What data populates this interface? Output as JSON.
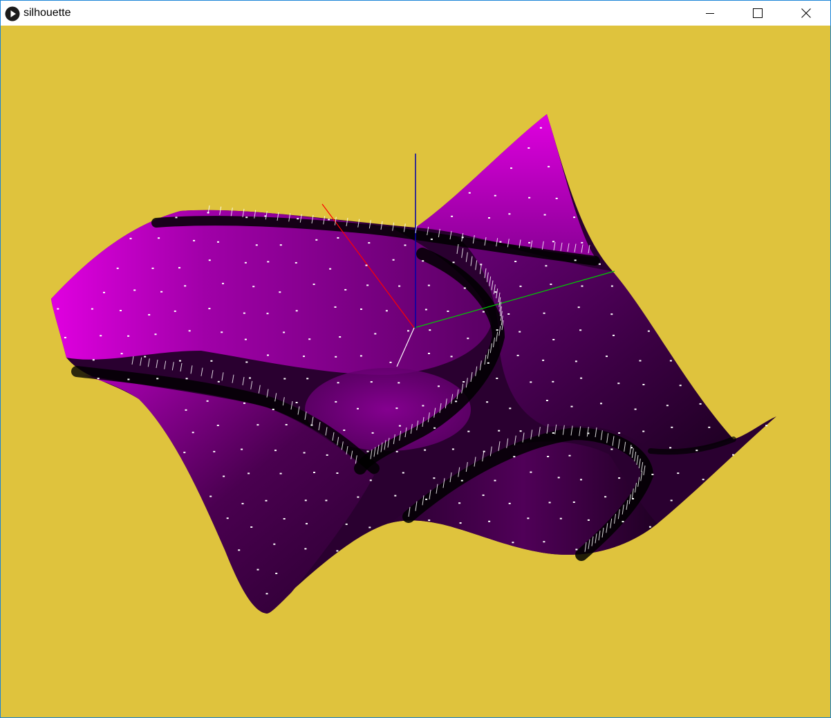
{
  "window": {
    "title": "silhouette",
    "controls": {
      "minimize_icon": "minimize-icon",
      "maximize_icon": "maximize-icon",
      "close_icon": "close-icon"
    }
  },
  "scene": {
    "background_color": "#dfc33d",
    "surface_color": "#e000e0",
    "shadow_color": "#000000",
    "marker_color": "#ffffff",
    "axes": {
      "x_color": "#ff0000",
      "y_color": "#00cc00",
      "z_color": "#0000aa"
    }
  }
}
